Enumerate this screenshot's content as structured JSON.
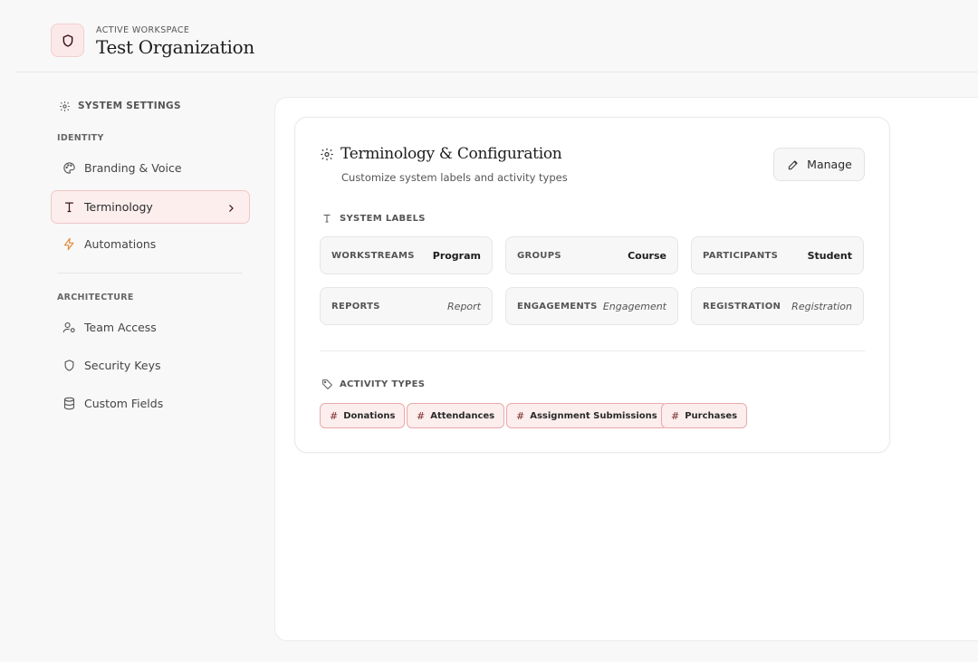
{
  "header": {
    "workspace_label": "ACTIVE WORKSPACE",
    "workspace_name": "Test Organization",
    "logo_icon": "shield-icon"
  },
  "sidebar": {
    "title": "SYSTEM SETTINGS",
    "sections": [
      {
        "label": "IDENTITY",
        "items": [
          {
            "label": "Branding & Voice",
            "icon": "palette-icon",
            "active": false
          },
          {
            "label": "Terminology",
            "icon": "type-icon",
            "active": true
          },
          {
            "label": "Automations",
            "icon": "lightning-icon",
            "active": false
          }
        ]
      },
      {
        "label": "ARCHITECTURE",
        "items": [
          {
            "label": "Team Access",
            "icon": "user-cog-icon",
            "active": false
          },
          {
            "label": "Security Keys",
            "icon": "shield-icon",
            "active": false
          },
          {
            "label": "Custom Fields",
            "icon": "database-icon",
            "active": false
          }
        ]
      }
    ]
  },
  "card": {
    "title": "Terminology & Configuration",
    "subtitle": "Customize system labels and activity types",
    "manage_label": "Manage",
    "system_labels_heading": "SYSTEM LABELS",
    "labels": [
      {
        "key": "WORKSTREAMS",
        "value": "Program",
        "italic": false
      },
      {
        "key": "GROUPS",
        "value": "Course",
        "italic": false
      },
      {
        "key": "PARTICIPANTS",
        "value": "Student",
        "italic": false
      },
      {
        "key": "REPORTS",
        "value": "Report",
        "italic": true
      },
      {
        "key": "ENGAGEMENTS",
        "value": "Engagement",
        "italic": true
      },
      {
        "key": "REGISTRATION",
        "value": "Registration",
        "italic": true
      }
    ],
    "activity_types_heading": "ACTIVITY TYPES",
    "activity_types": [
      "Donations",
      "Attendances",
      "Assignment Submissions",
      "Purchases"
    ]
  },
  "colors": {
    "accent": "#7a2a2a",
    "active_bg": "#fdeeee",
    "active_border": "#f1c7c7",
    "automation_icon": "#e08a3c"
  }
}
